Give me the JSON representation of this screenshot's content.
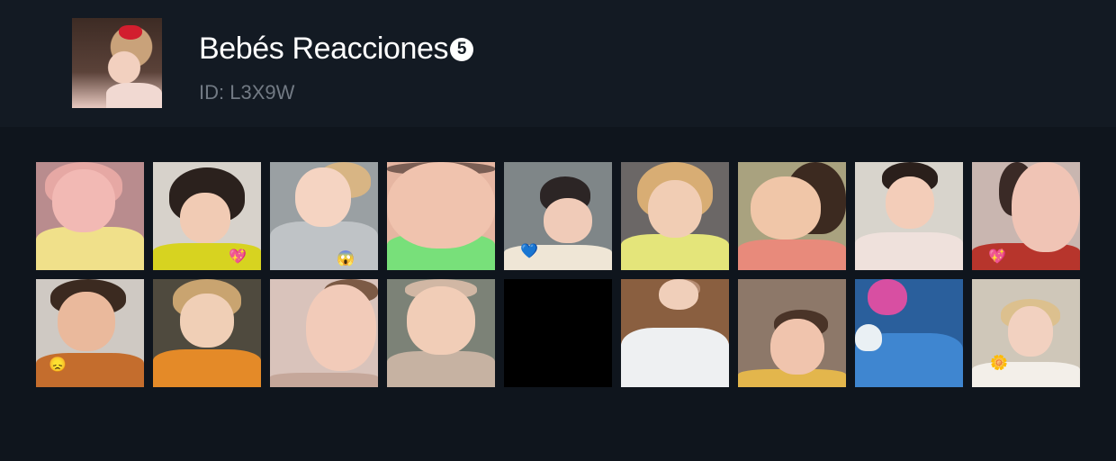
{
  "pack": {
    "title": "Bebés Reacciones",
    "badge": "5",
    "id_text": "ID: L3X9W",
    "thumbnail_icon": "baby-red-bow-thumbnail"
  },
  "colors": {
    "background": "#0f151d",
    "header_bg": "#131a23",
    "title": "#ffffff",
    "subtitle": "#727a84"
  },
  "stickers": [
    {
      "icon": "baby-sticker-icon",
      "emoji": ""
    },
    {
      "icon": "baby-sticker-icon",
      "emoji": "💖"
    },
    {
      "icon": "baby-sticker-icon",
      "emoji": "😱"
    },
    {
      "icon": "baby-sticker-icon",
      "emoji": ""
    },
    {
      "icon": "baby-sticker-icon",
      "emoji": "💙"
    },
    {
      "icon": "baby-sticker-icon",
      "emoji": ""
    },
    {
      "icon": "baby-sticker-icon",
      "emoji": ""
    },
    {
      "icon": "baby-sticker-icon",
      "emoji": ""
    },
    {
      "icon": "baby-sticker-icon",
      "emoji": "💖"
    },
    {
      "icon": "baby-sticker-icon",
      "emoji": "😞"
    },
    {
      "icon": "baby-sticker-icon",
      "emoji": ""
    },
    {
      "icon": "baby-sticker-icon",
      "emoji": ""
    },
    {
      "icon": "baby-sticker-icon",
      "emoji": ""
    },
    {
      "icon": "empty-sticker-icon",
      "emoji": ""
    },
    {
      "icon": "baby-sticker-icon",
      "emoji": ""
    },
    {
      "icon": "baby-sticker-icon",
      "emoji": ""
    },
    {
      "icon": "baby-sticker-icon",
      "emoji": ""
    },
    {
      "icon": "baby-sticker-icon",
      "emoji": "🌼"
    }
  ]
}
